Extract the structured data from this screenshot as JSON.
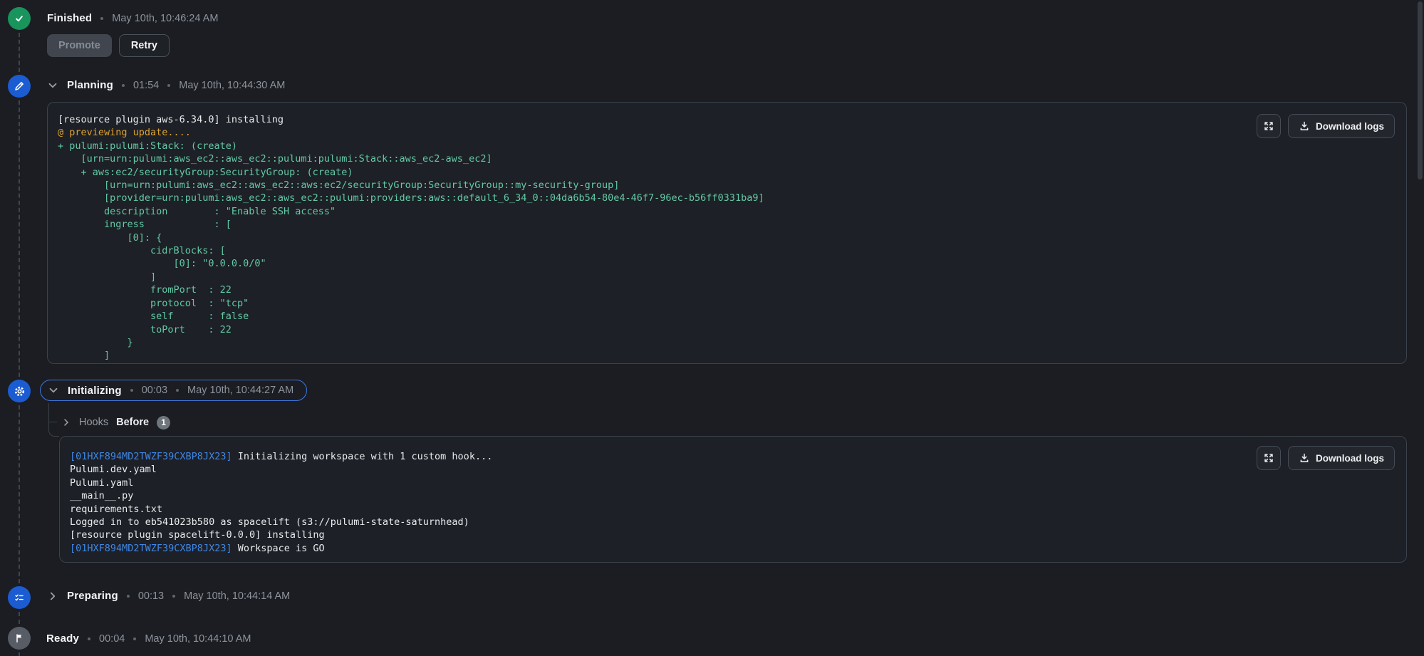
{
  "colors": {
    "page_bg": "#1b1d22",
    "accent_blue": "#1c5cd3",
    "success_green": "#18945c",
    "focus_ring": "#4078e0",
    "log_green": "#63c9a5",
    "log_orange": "#dfa22f",
    "log_blue": "#3f87e8"
  },
  "stages": {
    "finished": {
      "label": "Finished",
      "timestamp": "May 10th, 10:46:24 AM",
      "actions": {
        "promote": "Promote",
        "retry": "Retry"
      }
    },
    "planning": {
      "label": "Planning",
      "duration": "01:54",
      "timestamp": "May 10th, 10:44:30 AM"
    },
    "initializing": {
      "label": "Initializing",
      "duration": "00:03",
      "timestamp": "May 10th, 10:44:27 AM",
      "hooks": {
        "prefix": "Hooks",
        "name": "Before",
        "count": "1"
      }
    },
    "preparing": {
      "label": "Preparing",
      "duration": "00:13",
      "timestamp": "May 10th, 10:44:14 AM"
    },
    "ready": {
      "label": "Ready",
      "duration": "00:04",
      "timestamp": "May 10th, 10:44:10 AM"
    }
  },
  "log_panel": {
    "download_label": "Download logs"
  },
  "planning_log": [
    [
      {
        "c": "white",
        "t": "[resource plugin aws-6.34.0] installing"
      }
    ],
    [
      {
        "c": "orange",
        "t": "@ previewing update...."
      }
    ],
    [
      {
        "c": "green",
        "t": "+ pulumi:pulumi:Stack: (create)"
      }
    ],
    [
      {
        "c": "green",
        "t": "    [urn=urn:pulumi:aws_ec2::aws_ec2::pulumi:pulumi:Stack::aws_ec2-aws_ec2]"
      }
    ],
    [
      {
        "c": "green",
        "t": "    + aws:ec2/securityGroup:SecurityGroup: (create)"
      }
    ],
    [
      {
        "c": "green",
        "t": "        [urn=urn:pulumi:aws_ec2::aws_ec2::aws:ec2/securityGroup:SecurityGroup::my-security-group]"
      }
    ],
    [
      {
        "c": "green",
        "t": "        [provider=urn:pulumi:aws_ec2::aws_ec2::pulumi:providers:aws::default_6_34_0::04da6b54-80e4-46f7-96ec-b56ff0331ba9]"
      }
    ],
    [
      {
        "c": "green",
        "t": "        description        : \"Enable SSH access\""
      }
    ],
    [
      {
        "c": "green",
        "t": "        ingress            : ["
      }
    ],
    [
      {
        "c": "green",
        "t": "            [0]: {"
      }
    ],
    [
      {
        "c": "green",
        "t": "                cidrBlocks: ["
      }
    ],
    [
      {
        "c": "green",
        "t": "                    [0]: \"0.0.0.0/0\""
      }
    ],
    [
      {
        "c": "green",
        "t": "                ]"
      }
    ],
    [
      {
        "c": "green",
        "t": "                fromPort  : 22"
      }
    ],
    [
      {
        "c": "green",
        "t": "                protocol  : \"tcp\""
      }
    ],
    [
      {
        "c": "green",
        "t": "                self      : false"
      }
    ],
    [
      {
        "c": "green",
        "t": "                toPort    : 22"
      }
    ],
    [
      {
        "c": "green",
        "t": "            }"
      }
    ],
    [
      {
        "c": "green",
        "t": "        ]"
      }
    ]
  ],
  "initializing_log": [
    [
      {
        "c": "blue",
        "t": "[01HXF894MD2TWZF39CXBP8JX23]"
      },
      {
        "c": "white",
        "t": " Initializing workspace with 1 custom hook..."
      }
    ],
    [
      {
        "c": "white",
        "t": "Pulumi.dev.yaml"
      }
    ],
    [
      {
        "c": "white",
        "t": "Pulumi.yaml"
      }
    ],
    [
      {
        "c": "white",
        "t": "__main__.py"
      }
    ],
    [
      {
        "c": "white",
        "t": "requirements.txt"
      }
    ],
    [
      {
        "c": "white",
        "t": "Logged in to eb541023b580 as spacelift (s3://pulumi-state-saturnhead)"
      }
    ],
    [
      {
        "c": "white",
        "t": "[resource plugin spacelift-0.0.0] installing"
      }
    ],
    [
      {
        "c": "blue",
        "t": "[01HXF894MD2TWZF39CXBP8JX23]"
      },
      {
        "c": "white",
        "t": " Workspace is GO"
      }
    ]
  ]
}
